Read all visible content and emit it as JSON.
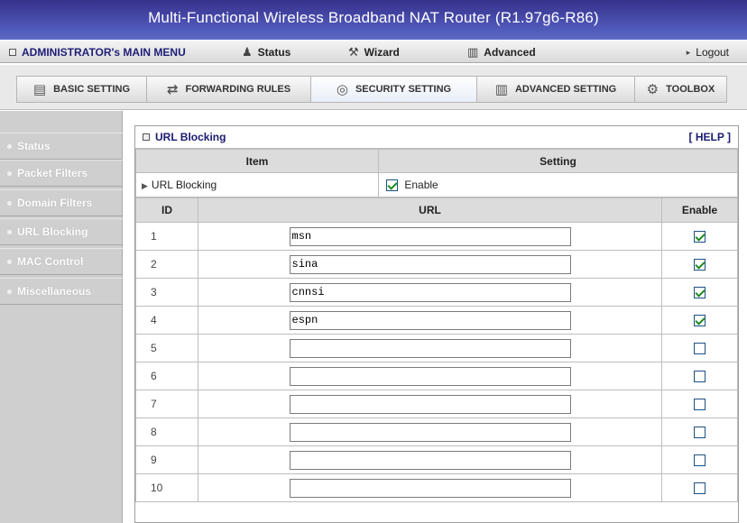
{
  "window": {
    "title": "Multi-Functional Wireless Broadband NAT Router (R1.97g6-R86)"
  },
  "menubar": {
    "admin_label": "ADMINISTRATOR's MAIN MENU",
    "status_label": "Status",
    "wizard_label": "Wizard",
    "advanced_label": "Advanced",
    "logout_label": "Logout"
  },
  "tabs": [
    {
      "label": "BASIC SETTING",
      "icon": "basic-setting-icon"
    },
    {
      "label": "FORWARDING RULES",
      "icon": "forwarding-rules-icon"
    },
    {
      "label": "SECURITY SETTING",
      "icon": "security-setting-icon",
      "active": true
    },
    {
      "label": "ADVANCED SETTING",
      "icon": "advanced-setting-icon"
    },
    {
      "label": "TOOLBOX",
      "icon": "toolbox-icon"
    }
  ],
  "sidebar": {
    "items": [
      {
        "label": "Status"
      },
      {
        "label": "Packet Filters"
      },
      {
        "label": "Domain Filters"
      },
      {
        "label": "URL Blocking"
      },
      {
        "label": "MAC Control"
      },
      {
        "label": "Miscellaneous"
      }
    ]
  },
  "panel": {
    "title": "URL Blocking",
    "help_label": "[ HELP ]",
    "col_item": "Item",
    "col_setting": "Setting",
    "url_blocking_label": "URL Blocking",
    "enable_label": "Enable",
    "url_blocking_enabled": true,
    "col_id": "ID",
    "col_url": "URL",
    "col_enable": "Enable",
    "rows": [
      {
        "id": "1",
        "url": "msn",
        "enabled": true
      },
      {
        "id": "2",
        "url": "sina",
        "enabled": true
      },
      {
        "id": "3",
        "url": "cnnsi",
        "enabled": true
      },
      {
        "id": "4",
        "url": "espn",
        "enabled": true
      },
      {
        "id": "5",
        "url": "",
        "enabled": false
      },
      {
        "id": "6",
        "url": "",
        "enabled": false
      },
      {
        "id": "7",
        "url": "",
        "enabled": false
      },
      {
        "id": "8",
        "url": "",
        "enabled": false
      },
      {
        "id": "9",
        "url": "",
        "enabled": false
      },
      {
        "id": "10",
        "url": "",
        "enabled": false
      }
    ]
  }
}
